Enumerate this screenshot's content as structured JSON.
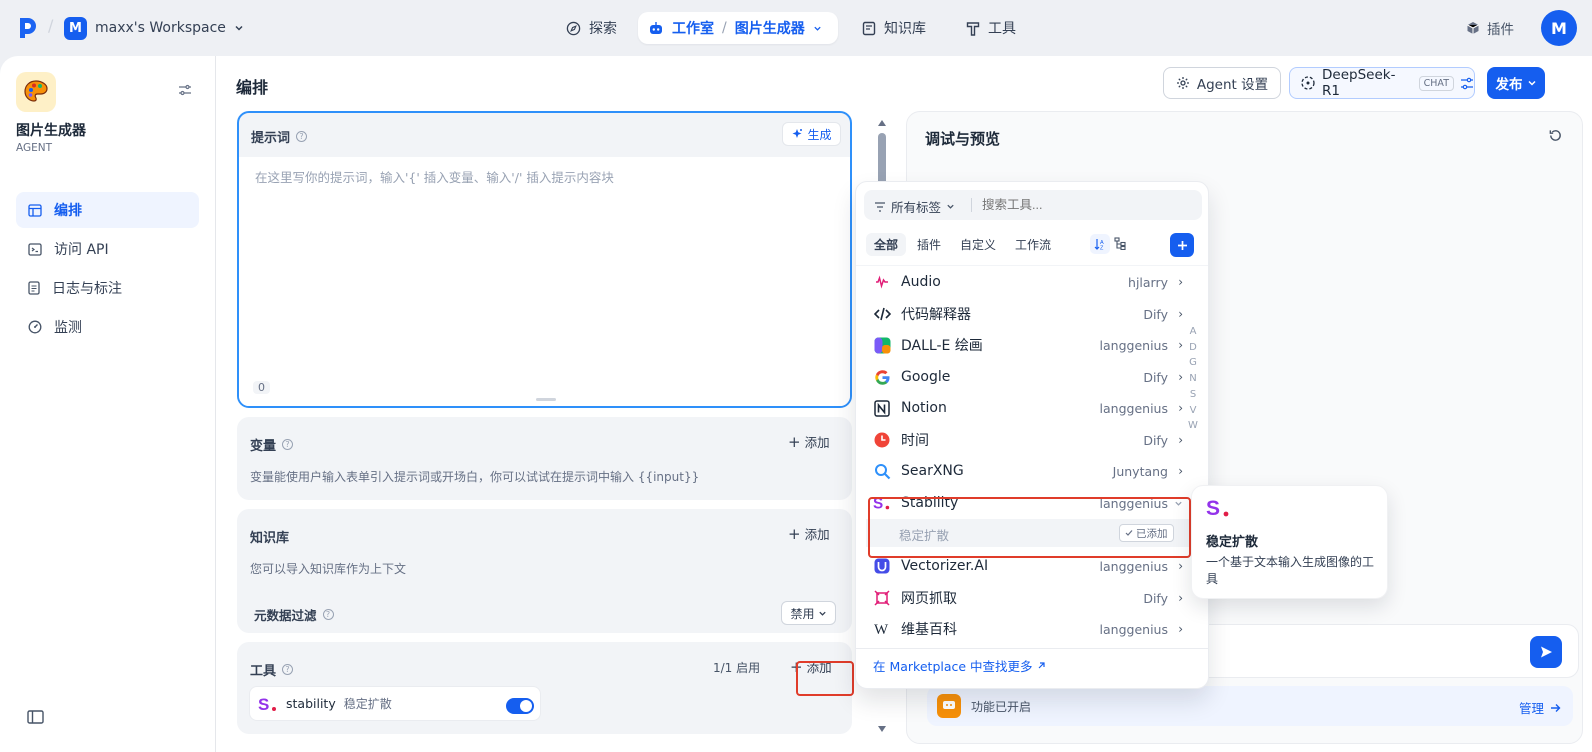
{
  "topbar": {
    "workspace_initial": "M",
    "workspace_name": "maxx's Workspace",
    "nav": {
      "explore": "探索",
      "studio": "工作室",
      "app": "图片生成器",
      "knowledge": "知识库",
      "tools": "工具"
    },
    "plugins": "插件",
    "avatar": "M"
  },
  "sidebar": {
    "app_name": "图片生成器",
    "app_type": "AGENT",
    "items": [
      {
        "label": "编排"
      },
      {
        "label": "访问 API"
      },
      {
        "label": "日志与标注"
      },
      {
        "label": "监测"
      }
    ]
  },
  "main": {
    "title": "编排",
    "agent_settings": "Agent 设置",
    "model": "DeepSeek-R1",
    "model_badge": "CHAT",
    "publish": "发布"
  },
  "prompt": {
    "title": "提示词",
    "generate": "生成",
    "placeholder": "在这里写你的提示词，输入'{' 插入变量、输入'/' 插入提示内容块",
    "count": "0"
  },
  "variables": {
    "title": "变量",
    "add": "添加",
    "desc": "变量能使用户输入表单引入提示词或开场白，你可以试试在提示词中输入 {{input}}"
  },
  "knowledge": {
    "title": "知识库",
    "add": "添加",
    "desc": "您可以导入知识库作为上下文",
    "meta_filter": "元数据过滤",
    "meta_value": "禁用"
  },
  "tools": {
    "title": "工具",
    "status": "1/1 启用",
    "add": "添加",
    "item_name": "stability",
    "item_desc": "稳定扩散",
    "enabled": true
  },
  "debug": {
    "title": "调试与预览",
    "feature_text": "功能已开启",
    "manage": "管理"
  },
  "popup": {
    "tag_filter": "所有标签",
    "search_placeholder": "搜索工具...",
    "tabs": [
      "全部",
      "插件",
      "自定义",
      "工作流"
    ],
    "tools": [
      {
        "name": "Audio",
        "author": "hjlarry",
        "icon": "audio-icon"
      },
      {
        "name": "代码解释器",
        "author": "Dify",
        "icon": "code-icon"
      },
      {
        "name": "DALL-E 绘画",
        "author": "langgenius",
        "icon": "dalle-icon"
      },
      {
        "name": "Google",
        "author": "Dify",
        "icon": "google-icon"
      },
      {
        "name": "Notion",
        "author": "langgenius",
        "icon": "notion-icon"
      },
      {
        "name": "时间",
        "author": "Dify",
        "icon": "clock-icon"
      },
      {
        "name": "SearXNG",
        "author": "Junytang",
        "icon": "searxng-icon"
      },
      {
        "name": "Stability",
        "author": "langgenius",
        "icon": "stability-icon"
      },
      {
        "name": "Vectorizer.AI",
        "author": "langgenius",
        "icon": "vectorizer-icon"
      },
      {
        "name": "网页抓取",
        "author": "Dify",
        "icon": "webscraper-icon"
      },
      {
        "name": "维基百科",
        "author": "langgenius",
        "icon": "wikipedia-icon"
      }
    ],
    "sub_tool": "稳定扩散",
    "added_badge": "已添加",
    "alphabet": [
      "A",
      "D",
      "G",
      "N",
      "S",
      "V",
      "W"
    ],
    "marketplace": "在 Marketplace 中查找更多"
  },
  "tooltip": {
    "title": "稳定扩散",
    "desc": "一个基于文本输入生成图像的工具"
  }
}
